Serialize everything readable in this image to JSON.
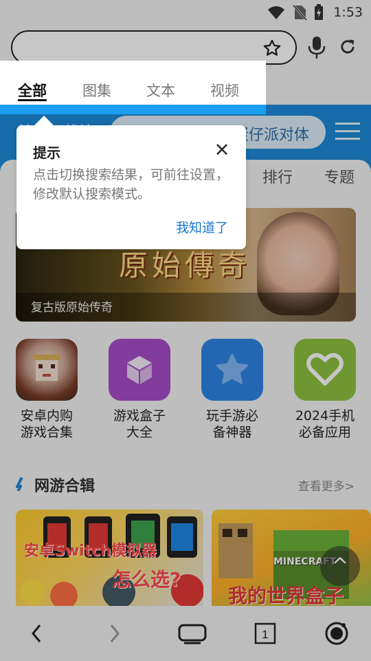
{
  "status_bar": {
    "time": "1:53",
    "icons": [
      "wifi-icon",
      "no-sim-icon",
      "battery-charging-icon"
    ]
  },
  "search_bar": {
    "value": "",
    "icons": [
      "star-icon",
      "mic-icon",
      "reload-icon"
    ]
  },
  "hero": {
    "left_text": "精品下载站",
    "search_hint": "派对 — 蛋仔派对体"
  },
  "content_tabs": [
    "排行",
    "专题"
  ],
  "banner": {
    "caption": "复古版原始传奇",
    "art_text": "原始傳奇"
  },
  "apps": [
    {
      "label": "安卓内购游戏合集",
      "line1": "安卓内购",
      "line2": "游戏合集",
      "color": "#cfb9b0"
    },
    {
      "label": "游戏盒子大全",
      "line1": "游戏盒子",
      "line2": "大全",
      "color": "#a64ec9"
    },
    {
      "label": "玩手游必备神器",
      "line1": "玩手游必",
      "line2": "备神器",
      "color": "#2d84e6"
    },
    {
      "label": "2024手机必备应用推荐",
      "line1": "2024手机",
      "line2": "必备应用",
      "color": "#8ec241"
    }
  ],
  "section": {
    "title": "网游合辑",
    "more": "查看更多>"
  },
  "cards": [
    {
      "art_text_1": "安卓Switch模拟器",
      "art_text_2": "怎么选?"
    },
    {
      "art_text_1": "MINECRAFT",
      "art_text_2": "我的世界盒子"
    }
  ],
  "scope_tabs": [
    "全部",
    "图集",
    "文本",
    "视频"
  ],
  "active_scope_tab": 0,
  "popup": {
    "title": "提示",
    "description": "点击切换搜索结果，可前往设置，修改默认搜索模式。",
    "confirm": "我知道了"
  },
  "scroll_top_label": "^",
  "nav_bar": {
    "tab_count": "1",
    "icons": [
      "back-icon",
      "forward-icon",
      "tv-icon",
      "tabs-icon",
      "camera-icon"
    ]
  },
  "colors": {
    "brand_blue": "#1d8ad8",
    "accent_blue": "#1a9ff0",
    "link_blue": "#1877d2"
  }
}
